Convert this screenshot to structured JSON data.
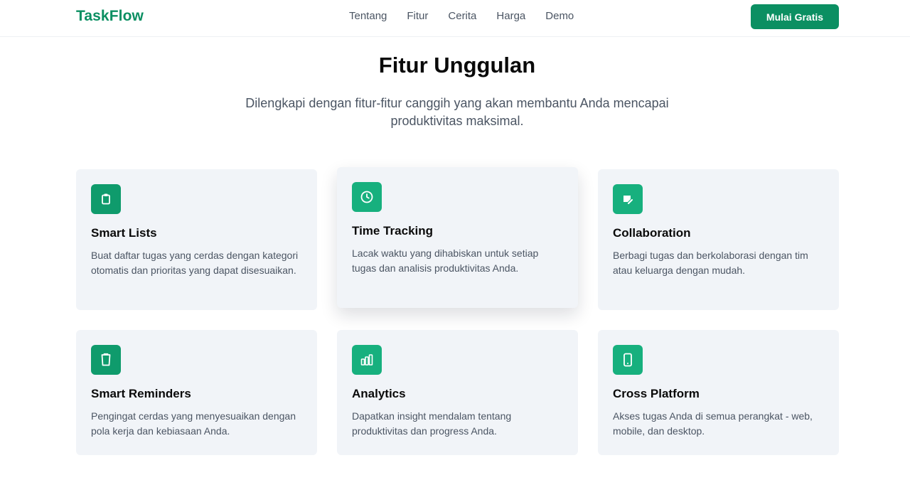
{
  "brand": {
    "name": "TaskFlow",
    "color": "#0b8f62"
  },
  "nav": {
    "links": [
      "Tentang",
      "Fitur",
      "Cerita",
      "Harga",
      "Demo"
    ],
    "cta_label": "Mulai Gratis"
  },
  "section": {
    "title": "Fitur Unggulan",
    "subtitle": "Dilengkapi dengan fitur-fitur canggih yang akan membantu Anda mencapai produktivitas maksimal."
  },
  "features": [
    {
      "icon": "clipboard-icon",
      "title": "Smart Lists",
      "description": "Buat daftar tugas yang cerdas dengan kategori otomatis dan prioritas yang dapat disesuaikan."
    },
    {
      "icon": "clock-icon",
      "title": "Time Tracking",
      "description": "Lacak waktu yang dihabiskan untuk setiap tugas dan analisis produktivitas Anda."
    },
    {
      "icon": "share-icon",
      "title": "Collaboration",
      "description": "Berbagi tugas dan berkolaborasi dengan tim atau keluarga dengan mudah."
    },
    {
      "icon": "bell-icon",
      "title": "Smart Reminders",
      "description": "Pengingat cerdas yang menyesuaikan dengan pola kerja dan kebiasaan Anda."
    },
    {
      "icon": "chart-icon",
      "title": "Analytics",
      "description": "Dapatkan insight mendalam tentang produktivitas dan progress Anda."
    },
    {
      "icon": "mobile-icon",
      "title": "Cross Platform",
      "description": "Akses tugas Anda di semua perangkat - web, mobile, dan desktop."
    }
  ],
  "colors": {
    "accent": "#0b8f62",
    "icon_bg": "#0f9b6c",
    "icon_bg_light": "#17b07e",
    "card_bg": "#f1f4f8"
  }
}
